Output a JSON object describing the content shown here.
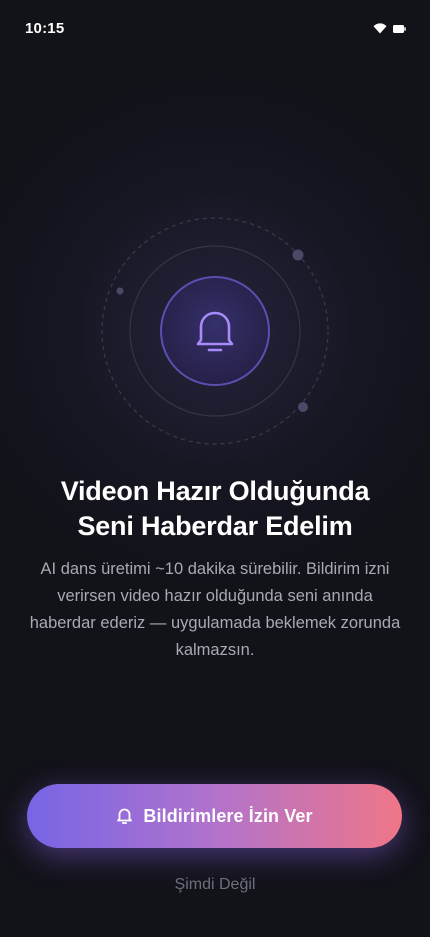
{
  "status_bar": {
    "time": "10:15",
    "icons": [
      "wifi-icon",
      "battery-icon"
    ]
  },
  "illustration": {
    "icon": "bell-icon",
    "accent": "#a78bfa"
  },
  "content": {
    "title_line1": "Videon Hazır Olduğunda",
    "title_line2": "Seni Haberdar Edelim",
    "body_line1": "AI dans üretimi ~10 dakika sürebilir. Bildirim izni",
    "body_line2": "verirsen video hazır olduğunda seni anında",
    "body_line3": "haberdar ederiz — uygulamada beklemek zorunda",
    "body_line4": "kalmazsın."
  },
  "actions": {
    "allow_label": "Bildirimlere İzin Ver",
    "allow_icon": "bell-icon",
    "skip_label": "Şimdi Değil"
  },
  "colors": {
    "background": "#121219",
    "gradient_start": "#7765e6",
    "gradient_end": "#ef7688"
  }
}
